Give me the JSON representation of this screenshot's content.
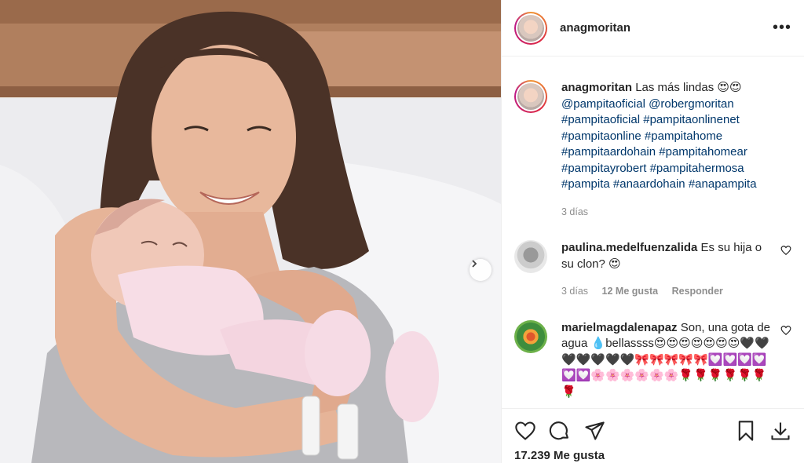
{
  "post": {
    "username": "anagmoritan",
    "more_label": "•••",
    "caption_text": "Las más lindas 😍😍",
    "caption_tags": [
      "@pampitaoficial",
      "@robergmoritan",
      "#pampitaoficial",
      "#pampitaonlinenet",
      "#pampitaonline",
      "#pampitahome",
      "#pampitaardohain",
      "#pampitahomear",
      "#pampitayrobert",
      "#pampitahermosa",
      "#pampita",
      "#anaardohain",
      "#anapampita"
    ],
    "caption_time": "3 días",
    "likes": "17.239 Me gusta"
  },
  "comments": [
    {
      "username": "paulina.medelfuenzalida",
      "text": "Es su hija o su clon? 😍",
      "time": "3 días",
      "likes": "12 Me gusta",
      "reply": "Responder"
    },
    {
      "username": "marielmagdalenapaz",
      "text": "Son, una gota de agua 💧bellassss😍😍😍😍😍😍😍🖤🖤🖤🖤🖤🖤🖤🎀🎀🎀🎀🎀💟💟💟💟💟💟🌸🌸🌸🌸🌸🌸🌹🌹🌹🌹🌹🌹🌹"
    }
  ],
  "icons": {
    "like": "heart-icon",
    "comment": "comment-icon",
    "share": "share-icon",
    "save": "bookmark-icon",
    "download": "download-icon",
    "next": "chevron-right-icon"
  }
}
